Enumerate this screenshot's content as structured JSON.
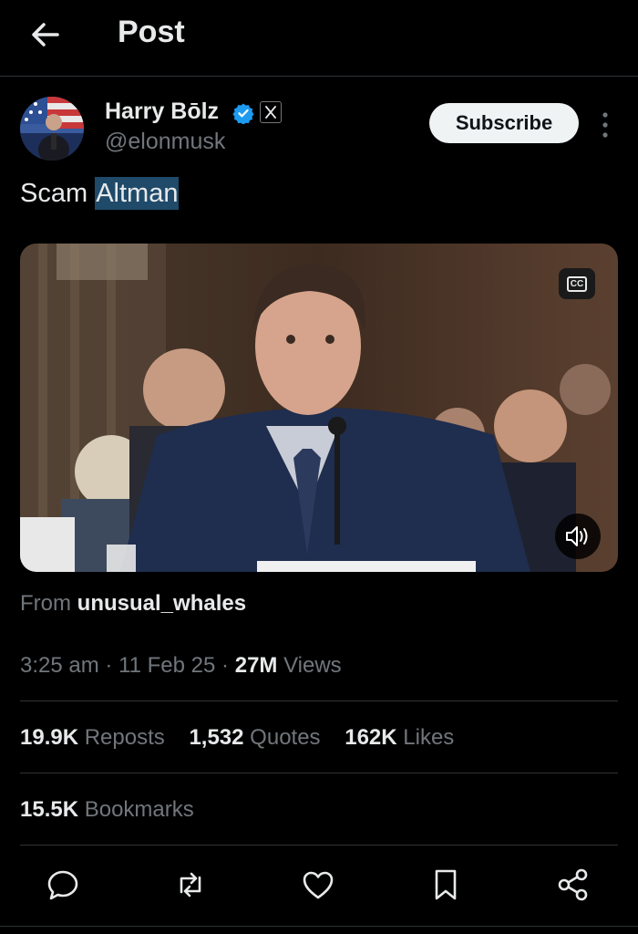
{
  "header": {
    "title": "Post",
    "back_icon": "arrow-left-icon"
  },
  "author": {
    "name": "Harry Bōlz",
    "handle": "@elonmusk",
    "verified_color": "#1d9bf0",
    "affiliate_badge": "X"
  },
  "subscribe_label": "Subscribe",
  "tweet": {
    "text_plain": "Scam ",
    "text_highlighted": "Altman",
    "highlight_color": "#1f4a6a"
  },
  "media": {
    "cc_label": "CC",
    "volume_icon": "volume-icon"
  },
  "source": {
    "prefix": "From",
    "account": "unusual_whales"
  },
  "meta": {
    "time": "3:25 am",
    "sep1": "·",
    "date": "11 Feb 25",
    "sep2": "·",
    "views_count": "27M",
    "views_label": "Views"
  },
  "stats": {
    "reposts": {
      "count": "19.9K",
      "label": "Reposts"
    },
    "quotes": {
      "count": "1,532",
      "label": "Quotes"
    },
    "likes": {
      "count": "162K",
      "label": "Likes"
    },
    "bookmarks": {
      "count": "15.5K",
      "label": "Bookmarks"
    }
  },
  "actions": [
    "reply-icon",
    "repost-icon",
    "like-icon",
    "bookmark-icon",
    "share-icon"
  ]
}
